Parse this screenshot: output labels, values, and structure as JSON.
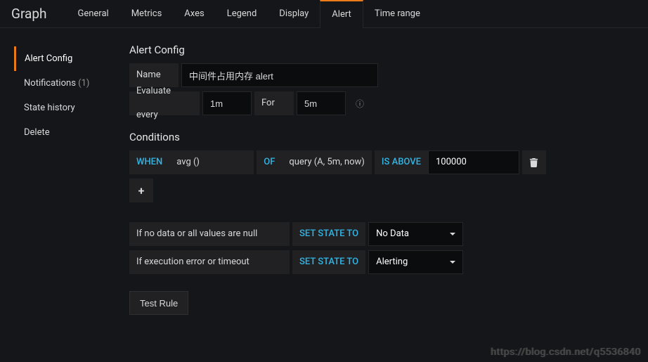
{
  "panelTitle": "Graph",
  "tabs": [
    "General",
    "Metrics",
    "Axes",
    "Legend",
    "Display",
    "Alert",
    "Time range"
  ],
  "activeTab": "Alert",
  "sidebar": {
    "items": [
      {
        "label": "Alert Config",
        "active": true
      },
      {
        "label": "Notifications",
        "count": "(1)"
      },
      {
        "label": "State history"
      },
      {
        "label": "Delete"
      }
    ]
  },
  "alert": {
    "heading": "Alert Config",
    "nameLabel": "Name",
    "nameValue": "中间件占用内存 alert",
    "evaluateLabel": "Evaluate every",
    "evaluateValue": "1m",
    "forLabel": "For",
    "forValue": "5m"
  },
  "conditions": {
    "heading": "Conditions",
    "whenLabel": "WHEN",
    "aggregator": "avg ()",
    "ofLabel": "OF",
    "query": "query (A, 5m, now)",
    "evaluatorLabel": "IS ABOVE",
    "threshold": "100000"
  },
  "noData": {
    "label": "If no data or all values are null",
    "action": "SET STATE TO",
    "value": "No Data"
  },
  "execError": {
    "label": "If execution error or timeout",
    "action": "SET STATE TO",
    "value": "Alerting"
  },
  "testRuleLabel": "Test Rule",
  "watermark": "https://blog.csdn.net/q5536840"
}
